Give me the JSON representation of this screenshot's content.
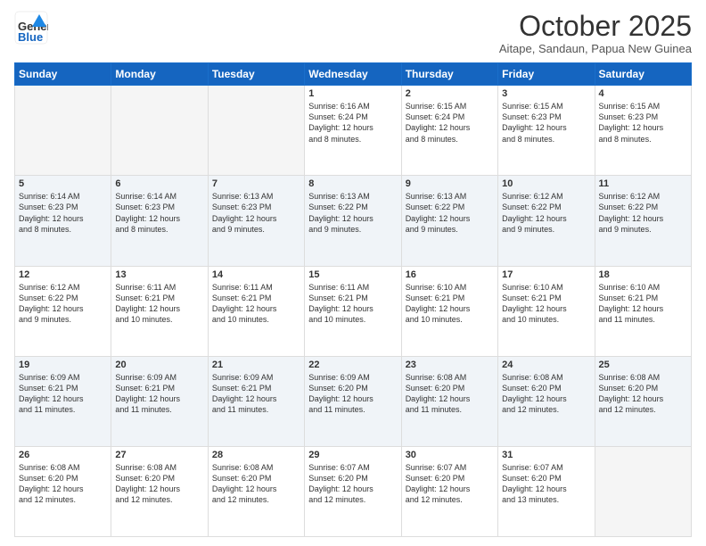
{
  "logo": {
    "line1": "General",
    "line2": "Blue"
  },
  "title": "October 2025",
  "subtitle": "Aitape, Sandaun, Papua New Guinea",
  "days_of_week": [
    "Sunday",
    "Monday",
    "Tuesday",
    "Wednesday",
    "Thursday",
    "Friday",
    "Saturday"
  ],
  "weeks": [
    [
      {
        "day": "",
        "info": ""
      },
      {
        "day": "",
        "info": ""
      },
      {
        "day": "",
        "info": ""
      },
      {
        "day": "1",
        "info": "Sunrise: 6:16 AM\nSunset: 6:24 PM\nDaylight: 12 hours\nand 8 minutes."
      },
      {
        "day": "2",
        "info": "Sunrise: 6:15 AM\nSunset: 6:24 PM\nDaylight: 12 hours\nand 8 minutes."
      },
      {
        "day": "3",
        "info": "Sunrise: 6:15 AM\nSunset: 6:23 PM\nDaylight: 12 hours\nand 8 minutes."
      },
      {
        "day": "4",
        "info": "Sunrise: 6:15 AM\nSunset: 6:23 PM\nDaylight: 12 hours\nand 8 minutes."
      }
    ],
    [
      {
        "day": "5",
        "info": "Sunrise: 6:14 AM\nSunset: 6:23 PM\nDaylight: 12 hours\nand 8 minutes."
      },
      {
        "day": "6",
        "info": "Sunrise: 6:14 AM\nSunset: 6:23 PM\nDaylight: 12 hours\nand 8 minutes."
      },
      {
        "day": "7",
        "info": "Sunrise: 6:13 AM\nSunset: 6:23 PM\nDaylight: 12 hours\nand 9 minutes."
      },
      {
        "day": "8",
        "info": "Sunrise: 6:13 AM\nSunset: 6:22 PM\nDaylight: 12 hours\nand 9 minutes."
      },
      {
        "day": "9",
        "info": "Sunrise: 6:13 AM\nSunset: 6:22 PM\nDaylight: 12 hours\nand 9 minutes."
      },
      {
        "day": "10",
        "info": "Sunrise: 6:12 AM\nSunset: 6:22 PM\nDaylight: 12 hours\nand 9 minutes."
      },
      {
        "day": "11",
        "info": "Sunrise: 6:12 AM\nSunset: 6:22 PM\nDaylight: 12 hours\nand 9 minutes."
      }
    ],
    [
      {
        "day": "12",
        "info": "Sunrise: 6:12 AM\nSunset: 6:22 PM\nDaylight: 12 hours\nand 9 minutes."
      },
      {
        "day": "13",
        "info": "Sunrise: 6:11 AM\nSunset: 6:21 PM\nDaylight: 12 hours\nand 10 minutes."
      },
      {
        "day": "14",
        "info": "Sunrise: 6:11 AM\nSunset: 6:21 PM\nDaylight: 12 hours\nand 10 minutes."
      },
      {
        "day": "15",
        "info": "Sunrise: 6:11 AM\nSunset: 6:21 PM\nDaylight: 12 hours\nand 10 minutes."
      },
      {
        "day": "16",
        "info": "Sunrise: 6:10 AM\nSunset: 6:21 PM\nDaylight: 12 hours\nand 10 minutes."
      },
      {
        "day": "17",
        "info": "Sunrise: 6:10 AM\nSunset: 6:21 PM\nDaylight: 12 hours\nand 10 minutes."
      },
      {
        "day": "18",
        "info": "Sunrise: 6:10 AM\nSunset: 6:21 PM\nDaylight: 12 hours\nand 11 minutes."
      }
    ],
    [
      {
        "day": "19",
        "info": "Sunrise: 6:09 AM\nSunset: 6:21 PM\nDaylight: 12 hours\nand 11 minutes."
      },
      {
        "day": "20",
        "info": "Sunrise: 6:09 AM\nSunset: 6:21 PM\nDaylight: 12 hours\nand 11 minutes."
      },
      {
        "day": "21",
        "info": "Sunrise: 6:09 AM\nSunset: 6:21 PM\nDaylight: 12 hours\nand 11 minutes."
      },
      {
        "day": "22",
        "info": "Sunrise: 6:09 AM\nSunset: 6:20 PM\nDaylight: 12 hours\nand 11 minutes."
      },
      {
        "day": "23",
        "info": "Sunrise: 6:08 AM\nSunset: 6:20 PM\nDaylight: 12 hours\nand 11 minutes."
      },
      {
        "day": "24",
        "info": "Sunrise: 6:08 AM\nSunset: 6:20 PM\nDaylight: 12 hours\nand 12 minutes."
      },
      {
        "day": "25",
        "info": "Sunrise: 6:08 AM\nSunset: 6:20 PM\nDaylight: 12 hours\nand 12 minutes."
      }
    ],
    [
      {
        "day": "26",
        "info": "Sunrise: 6:08 AM\nSunset: 6:20 PM\nDaylight: 12 hours\nand 12 minutes."
      },
      {
        "day": "27",
        "info": "Sunrise: 6:08 AM\nSunset: 6:20 PM\nDaylight: 12 hours\nand 12 minutes."
      },
      {
        "day": "28",
        "info": "Sunrise: 6:08 AM\nSunset: 6:20 PM\nDaylight: 12 hours\nand 12 minutes."
      },
      {
        "day": "29",
        "info": "Sunrise: 6:07 AM\nSunset: 6:20 PM\nDaylight: 12 hours\nand 12 minutes."
      },
      {
        "day": "30",
        "info": "Sunrise: 6:07 AM\nSunset: 6:20 PM\nDaylight: 12 hours\nand 12 minutes."
      },
      {
        "day": "31",
        "info": "Sunrise: 6:07 AM\nSunset: 6:20 PM\nDaylight: 12 hours\nand 13 minutes."
      },
      {
        "day": "",
        "info": ""
      }
    ]
  ]
}
